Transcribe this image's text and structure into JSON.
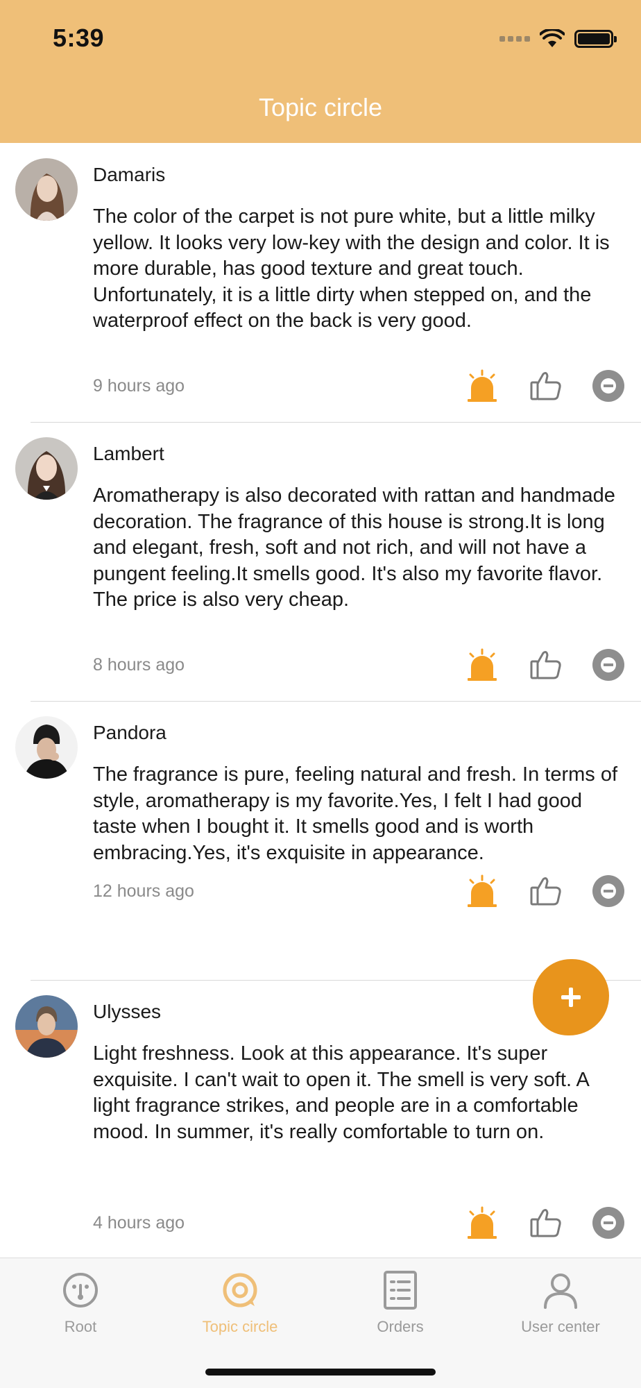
{
  "status_bar": {
    "time": "5:39"
  },
  "header": {
    "title": "Topic circle"
  },
  "posts": [
    {
      "author": "Damaris",
      "text": "The color of the carpet is not pure white, but a little milky yellow. It looks very low-key with the design and color. It is more durable, has good texture and great touch. Unfortunately, it is a little dirty when stepped on, and the waterproof effect on the back is very good.",
      "time_ago": "9 hours ago"
    },
    {
      "author": "Lambert",
      "text": "Aromatherapy is also decorated with rattan and handmade decoration. The fragrance of this house is strong.It is long and elegant, fresh, soft and not rich, and will not have a pungent feeling.It smells good. It's also my favorite flavor. The price is also very cheap.",
      "time_ago": "8 hours ago"
    },
    {
      "author": "Pandora",
      "text": "The fragrance is pure, feeling natural and fresh. In terms of style, aromatherapy is my favorite.Yes, I felt I had good taste when I bought it. It smells good and is worth embracing.Yes, it's exquisite in appearance.",
      "time_ago": "12 hours ago"
    },
    {
      "author": "Ulysses",
      "text": "Light freshness. Look at this appearance. It's super exquisite. I can't wait to open it. The smell is very soft. A light fragrance strikes, and people are in a comfortable mood. In summer, it's really comfortable to turn on.",
      "time_ago": "4 hours ago"
    }
  ],
  "post_actions": {
    "report_icon": "alarm-icon",
    "like_icon": "thumbs-up-icon",
    "block_icon": "minus-circle-icon"
  },
  "fab": {
    "icon": "plus-icon"
  },
  "tabs": [
    {
      "label": "Root",
      "icon": "home-dial-icon"
    },
    {
      "label": "Topic circle",
      "icon": "topic-circle-icon",
      "active": true
    },
    {
      "label": "Orders",
      "icon": "orders-list-icon"
    },
    {
      "label": "User center",
      "icon": "user-icon"
    }
  ],
  "colors": {
    "header_bg": "#efbf78",
    "accent": "#f5a024",
    "fab": "#e8941c",
    "active_tab": "#efbf78",
    "inactive_tab": "#9a9a9a"
  }
}
